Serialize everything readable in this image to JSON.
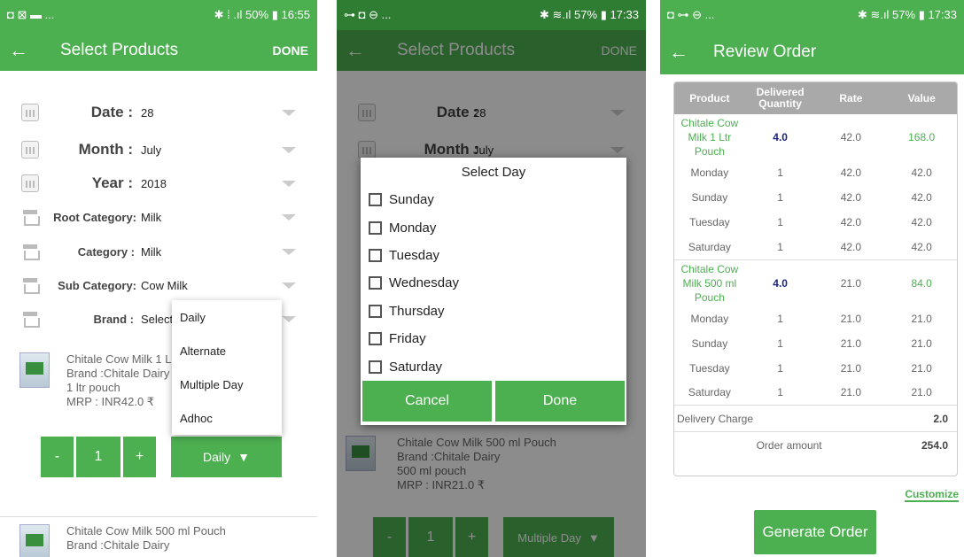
{
  "screen1": {
    "status": {
      "left": "◘ ⊠ ▬ ...",
      "right": "✱ ⁞ .ıl 50% ▮ 16:55"
    },
    "title": "Select Products",
    "done": "DONE",
    "fields": [
      {
        "label": "Date :",
        "value": "28"
      },
      {
        "label": "Month :",
        "value": "July"
      },
      {
        "label": "Year :",
        "value": "2018"
      },
      {
        "label": "Root Category:",
        "value": "Milk"
      },
      {
        "label": "Category :",
        "value": "Milk"
      },
      {
        "label": "Sub Category:",
        "value": "Cow Milk"
      },
      {
        "label": "Brand :",
        "value": "Select"
      }
    ],
    "product1": {
      "name": "Chitale Cow Milk 1 L",
      "brand": "Brand :Chitale Dairy",
      "pack": "1 ltr pouch",
      "mrp": "MRP : INR42.0 ₹"
    },
    "stepper": {
      "minus": "-",
      "qty": "1",
      "plus": "+"
    },
    "freq": "Daily",
    "menu": [
      "Daily",
      "Alternate",
      "Multiple Day",
      "Adhoc"
    ],
    "product2": {
      "name": "Chitale Cow Milk  500 ml Pouch",
      "brand": "Brand :Chitale Dairy"
    }
  },
  "screen2": {
    "status": {
      "left": "⊶ ◘ ⊖ ...",
      "right": "✱ ≋.ıl 57% ▮ 17:33"
    },
    "title": "Select Products",
    "done": "DONE",
    "fields": [
      {
        "label": "Date :",
        "value": "28"
      },
      {
        "label": "Month :",
        "value": "July"
      }
    ],
    "dialog_title": "Select Day",
    "days": [
      "Sunday",
      "Monday",
      "Tuesday",
      "Wednesday",
      "Thursday",
      "Friday",
      "Saturday"
    ],
    "cancel": "Cancel",
    "done_btn": "Done",
    "product": {
      "name": "Chitale Cow Milk  500 ml Pouch",
      "brand": "Brand :Chitale Dairy",
      "pack": "500 ml pouch",
      "mrp": "MRP : INR21.0 ₹"
    },
    "stepper": {
      "minus": "-",
      "qty": "1",
      "plus": "+"
    },
    "freq": "Multiple Day"
  },
  "screen3": {
    "status": {
      "left": "◘ ⊶ ⊖ ...",
      "right": "✱ ≋.ıl 57% ▮ 17:33"
    },
    "title": "Review Order",
    "headers": [
      "Product",
      "Delivered Quantity",
      "Rate",
      "Value"
    ],
    "groups": [
      {
        "product": "Chitale Cow Milk 1 Ltr Pouch",
        "qty": "4.0",
        "rate": "42.0",
        "value": "168.0",
        "days": [
          [
            "Monday",
            "1",
            "42.0",
            "42.0"
          ],
          [
            "Sunday",
            "1",
            "42.0",
            "42.0"
          ],
          [
            "Tuesday",
            "1",
            "42.0",
            "42.0"
          ],
          [
            "Saturday",
            "1",
            "42.0",
            "42.0"
          ]
        ]
      },
      {
        "product": "Chitale Cow Milk  500 ml Pouch",
        "qty": "4.0",
        "rate": "21.0",
        "value": "84.0",
        "days": [
          [
            "Monday",
            "1",
            "21.0",
            "21.0"
          ],
          [
            "Sunday",
            "1",
            "21.0",
            "21.0"
          ],
          [
            "Tuesday",
            "1",
            "21.0",
            "21.0"
          ],
          [
            "Saturday",
            "1",
            "21.0",
            "21.0"
          ]
        ]
      }
    ],
    "delivery_label": "Delivery Charge",
    "delivery_value": "2.0",
    "order_label": "Order amount",
    "order_value": "254.0",
    "customize": "Customize",
    "generate": "Generate Order"
  }
}
